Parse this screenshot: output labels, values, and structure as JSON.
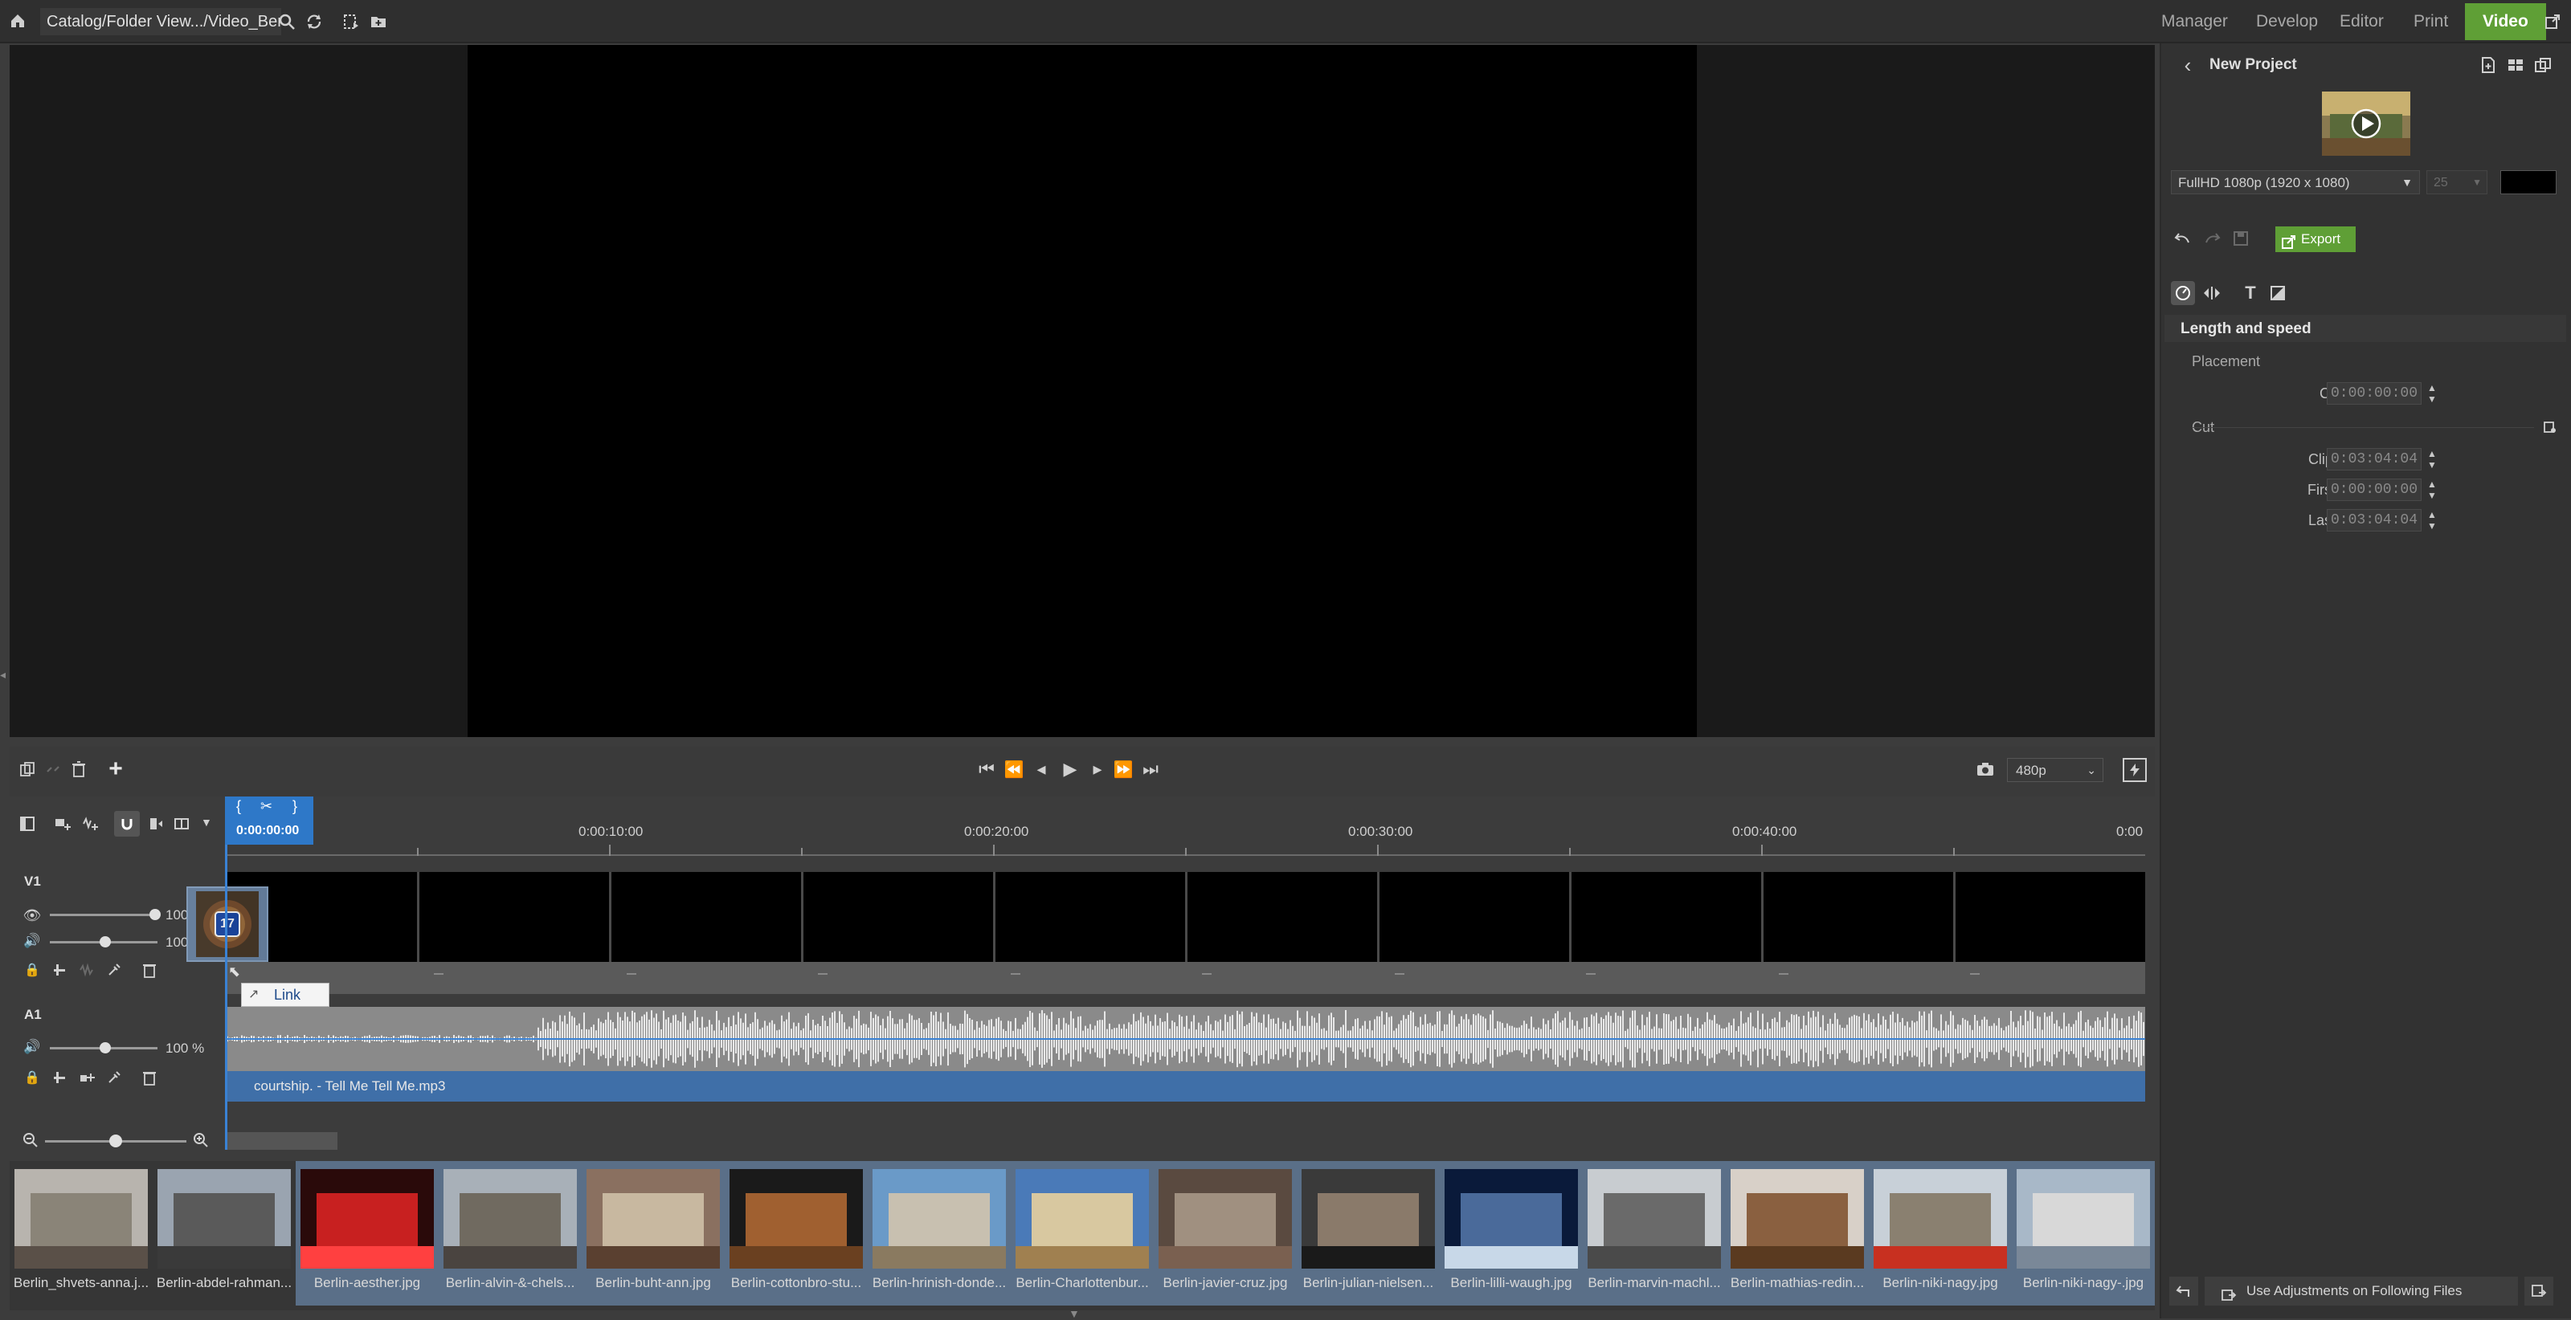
{
  "topbar": {
    "catalog_path": "Catalog/Folder View.../Video_Berlin",
    "nav": [
      "Manager",
      "Develop",
      "Editor",
      "Print",
      "Video"
    ]
  },
  "right_panel": {
    "project_title": "New Project",
    "resolution": "FullHD 1080p (1920 x 1080)",
    "fps": "25",
    "export_label": "Export",
    "section_title": "Length and speed",
    "placement_label": "Placement",
    "clip_start_label": "Clip start",
    "clip_start_value": "0:00:00:00",
    "cut_label": "Cut",
    "clip_length_label": "Clip length",
    "clip_length_value": "0:03:04:04",
    "first_frame_label": "First frame",
    "first_frame_value": "0:00:00:00",
    "last_frame_label": "Last frame",
    "last_frame_value": "0:03:04:04",
    "use_adjustments_label": "Use Adjustments on Following Files"
  },
  "timeline": {
    "preview_quality": "480p",
    "playhead_time": "0:00:00:00",
    "ruler_labels": [
      "0:00:10:00",
      "0:00:20:00",
      "0:00:30:00",
      "0:00:40:00",
      "0:00"
    ],
    "video_track_label": "V1",
    "audio_track_label": "A1",
    "video_opacity": "100",
    "video_volume": "100",
    "audio_volume": "100 %",
    "clip_badge": "17",
    "link_tooltip": "Link",
    "audio_clip_name": "courtship. - Tell Me Tell Me.mp3"
  },
  "filmstrip": {
    "items": [
      "Berlin_shvets-anna.j...",
      "Berlin-abdel-rahman...",
      "Berlin-aesther.jpg",
      "Berlin-alvin-&-chels...",
      "Berlin-buht-ann.jpg",
      "Berlin-cottonbro-stu...",
      "Berlin-hrinish-donde...",
      "Berlin-Charlottenbur...",
      "Berlin-javier-cruz.jpg",
      "Berlin-julian-nielsen...",
      "Berlin-lilli-waugh.jpg",
      "Berlin-marvin-machl...",
      "Berlin-mathias-redin...",
      "Berlin-niki-nagy.jpg",
      "Berlin-niki-nagy-.jpg"
    ]
  },
  "colors": {
    "accent_green": "#5f9f36",
    "accent_blue": "#2e78c8",
    "background": "#3c3c3c"
  }
}
